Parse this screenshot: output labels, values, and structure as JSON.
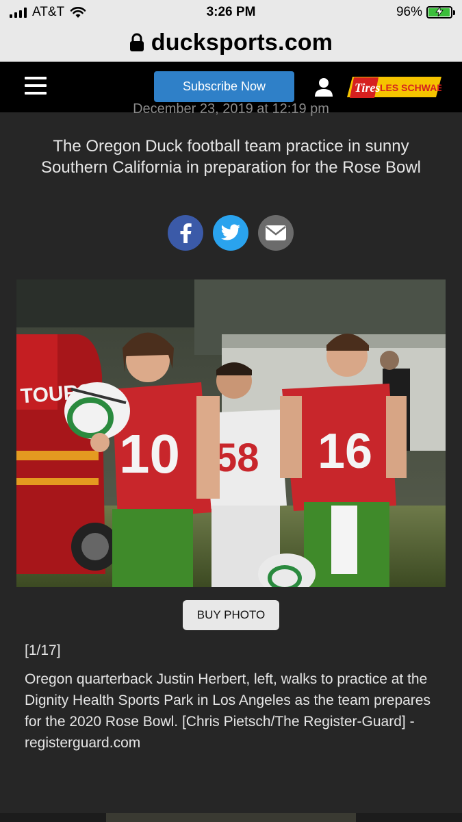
{
  "status_bar": {
    "carrier": "AT&T",
    "time": "3:26 PM",
    "battery": "96%",
    "battery_level": 0.96
  },
  "browser": {
    "url": "ducksports.com"
  },
  "header": {
    "subscribe_label": "Subscribe Now",
    "sponsor_word_1": "Tires",
    "sponsor_word_2": "LES SCHWAB"
  },
  "article": {
    "dateline": "December 23, 2019 at 12:19 pm",
    "headline": "The Oregon Duck football team practice in sunny Southern California in preparation for the Rose Bowl",
    "share": [
      "facebook-icon",
      "twitter-icon",
      "email-icon"
    ]
  },
  "photo": {
    "buy_label": "BUY PHOTO",
    "counter": "[1/17]",
    "caption": "Oregon quarterback Justin Herbert, left, walks to practice at the Dignity Health Sports Park in Los Angeles as the team prepares for the 2020 Rose Bowl. [Chris Pietsch/The Register-Guard] - registerguard.com",
    "bus_text": "TOURS",
    "jersey_numbers": [
      "10",
      "58",
      "16"
    ]
  },
  "colors": {
    "facebook": "#3b5aa8",
    "twitter": "#2aa3ee",
    "email": "#6b6b6b",
    "subscribe": "#2f80c8",
    "jersey_red": "#c8262b",
    "pants_green": "#3f8a2a"
  }
}
